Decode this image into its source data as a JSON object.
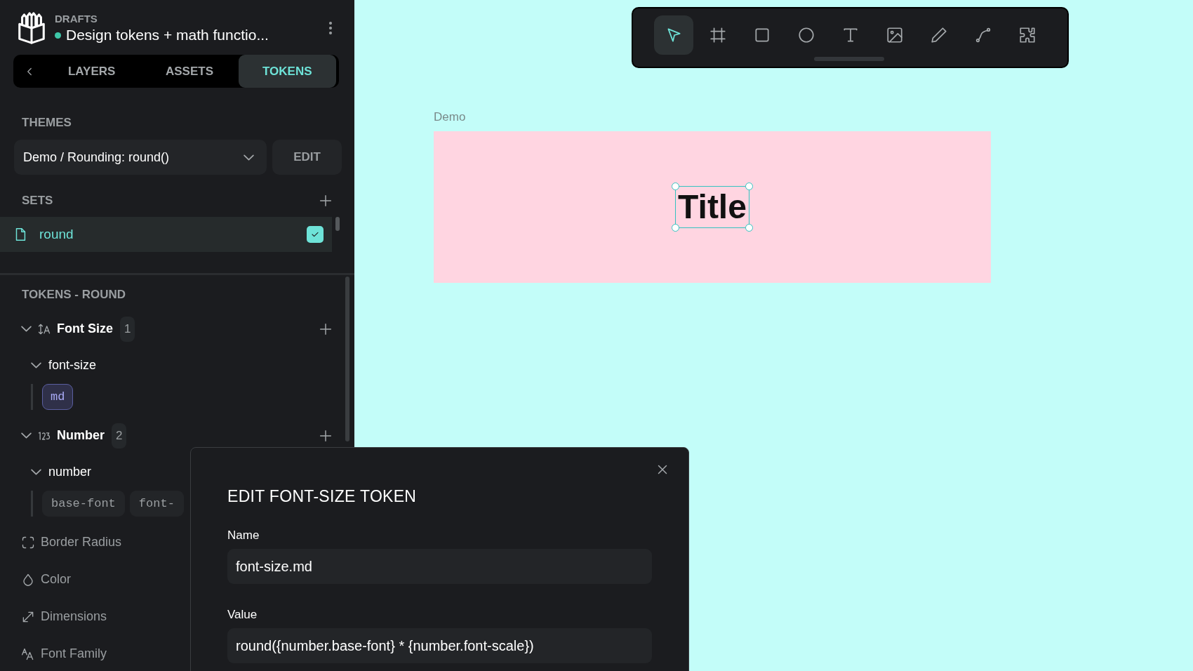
{
  "project": {
    "section": "DRAFTS",
    "title": "Design tokens + math functio..."
  },
  "tabs": [
    {
      "label": "LAYERS",
      "selected": false
    },
    {
      "label": "ASSETS",
      "selected": false
    },
    {
      "label": "TOKENS",
      "selected": true
    }
  ],
  "themes": {
    "heading": "THEMES",
    "selected_theme": "Demo / Rounding: round()",
    "edit_button": "EDIT"
  },
  "sets": {
    "heading": "SETS",
    "items": [
      {
        "name": "round",
        "selected": true,
        "checked": true
      }
    ]
  },
  "tokens": {
    "heading": "TOKENS - ROUND",
    "groups": [
      {
        "kind": "font-size",
        "name": "Font Size",
        "count": "1",
        "expanded": true,
        "disabled": false,
        "children": [
          {
            "name": "font-size",
            "expanded": true,
            "tokens": [
              {
                "name": "md",
                "selected": true
              }
            ]
          }
        ]
      },
      {
        "kind": "number",
        "name": "Number",
        "count": "2",
        "expanded": true,
        "disabled": false,
        "children": [
          {
            "name": "number",
            "expanded": true,
            "tokens": [
              {
                "name": "base-font",
                "selected": false
              },
              {
                "name": "font-",
                "selected": false
              }
            ]
          }
        ]
      },
      {
        "kind": "border-radius",
        "name": "Border Radius",
        "disabled": true
      },
      {
        "kind": "color",
        "name": "Color",
        "disabled": true
      },
      {
        "kind": "dimensions",
        "name": "Dimensions",
        "disabled": true
      },
      {
        "kind": "font-family",
        "name": "Font Family",
        "disabled": true
      }
    ]
  },
  "toolbar": {
    "tools": [
      {
        "kind": "pointer",
        "selected": true
      },
      {
        "kind": "frame",
        "selected": false
      },
      {
        "kind": "rectangle",
        "selected": false
      },
      {
        "kind": "ellipse",
        "selected": false
      },
      {
        "kind": "text",
        "selected": false
      },
      {
        "kind": "image",
        "selected": false
      },
      {
        "kind": "pencil",
        "selected": false
      },
      {
        "kind": "path",
        "selected": false
      },
      {
        "kind": "plugins",
        "selected": false
      }
    ]
  },
  "canvas": {
    "board": {
      "name": "Demo",
      "text": "Title",
      "selected": true
    }
  },
  "dialog": {
    "title": "EDIT FONT-SIZE TOKEN",
    "fields": [
      {
        "label": "Name",
        "value": "font-size.md"
      },
      {
        "label": "Value",
        "value": "round({number.base-font} * {number.font-scale})"
      }
    ]
  }
}
